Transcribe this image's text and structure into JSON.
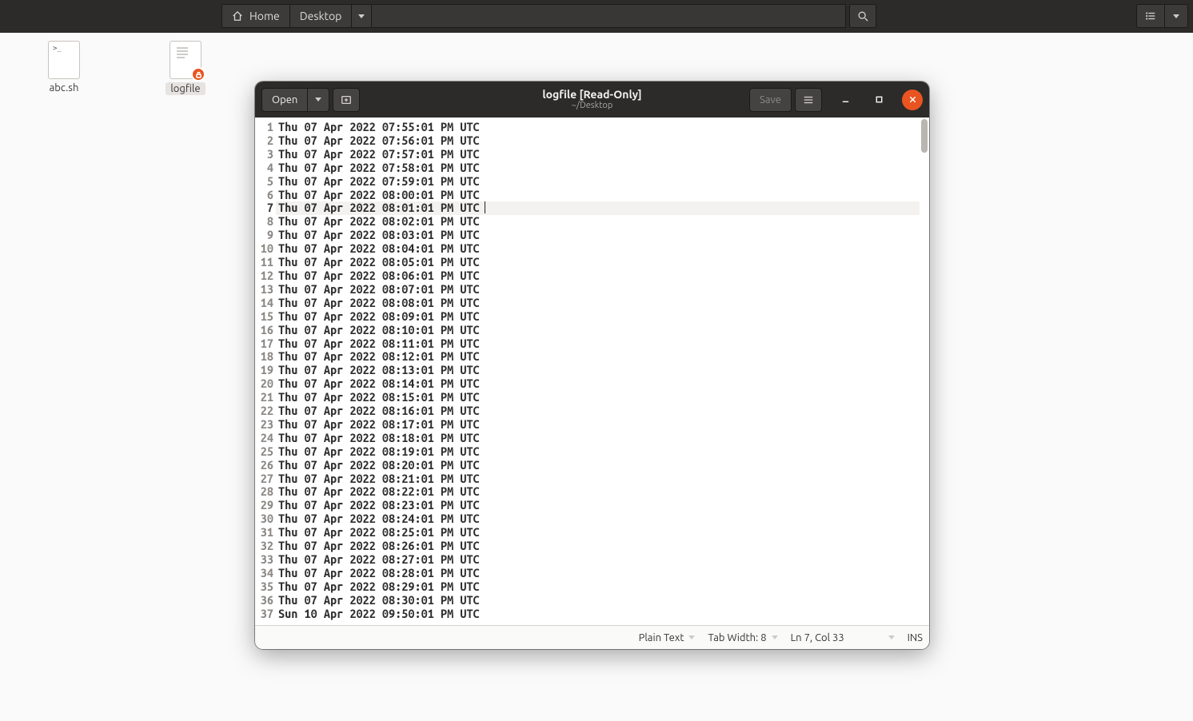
{
  "filemanager": {
    "breadcrumb": {
      "home": "Home",
      "desktop": "Desktop"
    }
  },
  "desktop": {
    "icons": [
      {
        "name": "abc.sh",
        "glyph": ">_",
        "locked": false,
        "selected": false
      },
      {
        "name": "logfile",
        "glyph": "",
        "locked": true,
        "selected": true
      }
    ]
  },
  "gedit": {
    "open_label": "Open",
    "save_label": "Save",
    "title": "logfile [Read-Only]",
    "subtitle": "~/Desktop",
    "current_line": 7,
    "lines": [
      "Thu 07 Apr 2022 07:55:01 PM UTC",
      "Thu 07 Apr 2022 07:56:01 PM UTC",
      "Thu 07 Apr 2022 07:57:01 PM UTC",
      "Thu 07 Apr 2022 07:58:01 PM UTC",
      "Thu 07 Apr 2022 07:59:01 PM UTC",
      "Thu 07 Apr 2022 08:00:01 PM UTC",
      "Thu 07 Apr 2022 08:01:01 PM UTC",
      "Thu 07 Apr 2022 08:02:01 PM UTC",
      "Thu 07 Apr 2022 08:03:01 PM UTC",
      "Thu 07 Apr 2022 08:04:01 PM UTC",
      "Thu 07 Apr 2022 08:05:01 PM UTC",
      "Thu 07 Apr 2022 08:06:01 PM UTC",
      "Thu 07 Apr 2022 08:07:01 PM UTC",
      "Thu 07 Apr 2022 08:08:01 PM UTC",
      "Thu 07 Apr 2022 08:09:01 PM UTC",
      "Thu 07 Apr 2022 08:10:01 PM UTC",
      "Thu 07 Apr 2022 08:11:01 PM UTC",
      "Thu 07 Apr 2022 08:12:01 PM UTC",
      "Thu 07 Apr 2022 08:13:01 PM UTC",
      "Thu 07 Apr 2022 08:14:01 PM UTC",
      "Thu 07 Apr 2022 08:15:01 PM UTC",
      "Thu 07 Apr 2022 08:16:01 PM UTC",
      "Thu 07 Apr 2022 08:17:01 PM UTC",
      "Thu 07 Apr 2022 08:18:01 PM UTC",
      "Thu 07 Apr 2022 08:19:01 PM UTC",
      "Thu 07 Apr 2022 08:20:01 PM UTC",
      "Thu 07 Apr 2022 08:21:01 PM UTC",
      "Thu 07 Apr 2022 08:22:01 PM UTC",
      "Thu 07 Apr 2022 08:23:01 PM UTC",
      "Thu 07 Apr 2022 08:24:01 PM UTC",
      "Thu 07 Apr 2022 08:25:01 PM UTC",
      "Thu 07 Apr 2022 08:26:01 PM UTC",
      "Thu 07 Apr 2022 08:27:01 PM UTC",
      "Thu 07 Apr 2022 08:28:01 PM UTC",
      "Thu 07 Apr 2022 08:29:01 PM UTC",
      "Thu 07 Apr 2022 08:30:01 PM UTC",
      "Sun 10 Apr 2022 09:50:01 PM UTC"
    ],
    "status": {
      "syntax": "Plain Text",
      "tabwidth": "Tab Width: 8",
      "position": "Ln 7, Col 33",
      "insert": "INS"
    }
  }
}
